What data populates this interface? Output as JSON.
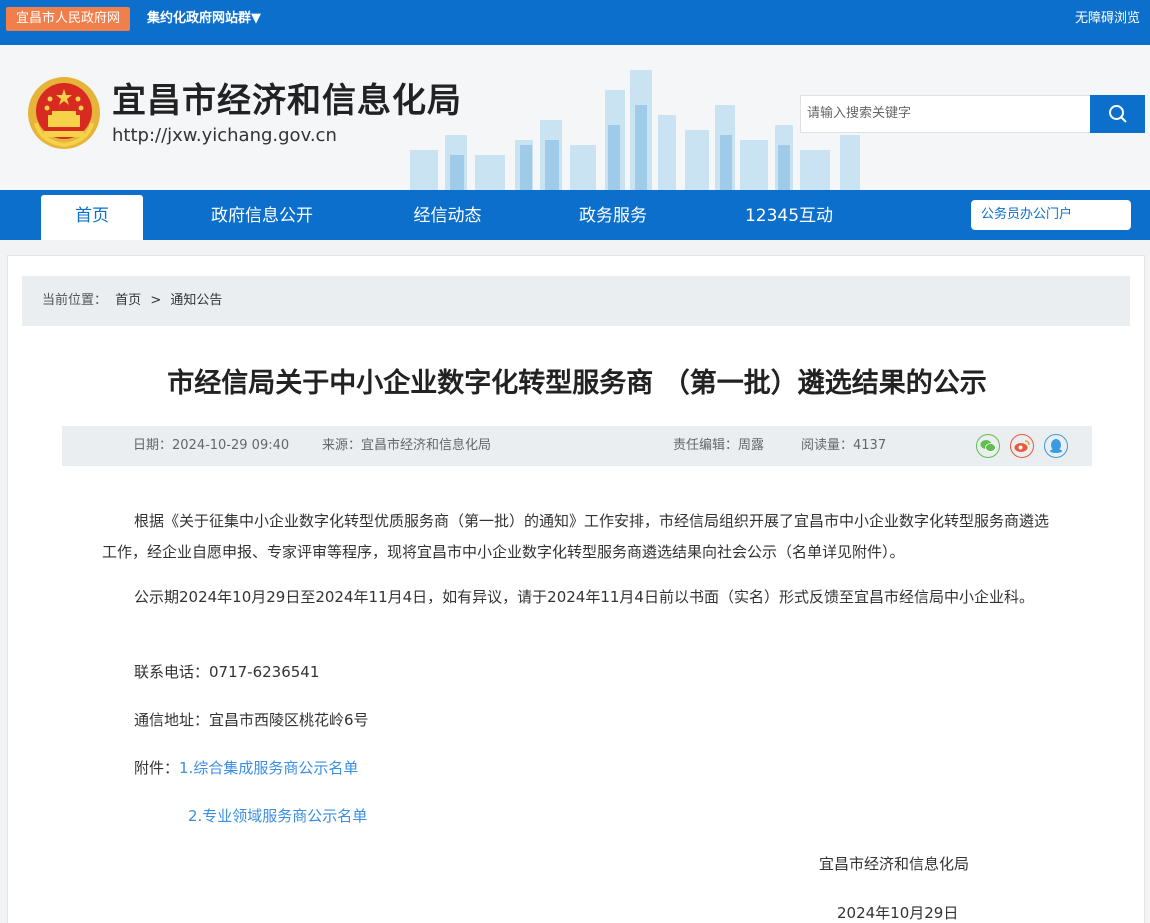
{
  "topbar": {
    "gov_link": "宜昌市人民政府网",
    "site_group": "集约化政府网站群▼",
    "accessibility": "无障碍浏览"
  },
  "header": {
    "title": "宜昌市经济和信息化局",
    "url": "http://jxw.yichang.gov.cn",
    "search_placeholder": "请输入搜索关键字"
  },
  "nav": {
    "items": [
      "首页",
      "政府信息公开",
      "经信动态",
      "政务服务",
      "12345互动"
    ],
    "active_index": 0,
    "portal": "公务员办公门户"
  },
  "breadcrumb": {
    "prefix": "当前位置：",
    "home": "首页",
    "separator": ">",
    "current": "通知公告"
  },
  "article": {
    "title": "市经信局关于中小企业数字化转型服务商 （第一批）遴选结果的公示",
    "date": "日期：2024-10-29 09:40",
    "source": "来源：宜昌市经济和信息化局",
    "editor": "责任编辑：周露",
    "views": "阅读量：4137",
    "para1": "根据《关于征集中小企业数字化转型优质服务商（第一批）的通知》工作安排，市经信局组织开展了宜昌市中小企业数字化转型服务商遴选工作，经企业自愿申报、专家评审等程序，现将宜昌市中小企业数字化转型服务商遴选结果向社会公示（名单详见附件）。",
    "para2": "公示期2024年10月29日至2024年11月4日，如有异议，请于2024年11月4日前以书面（实名）形式反馈至宜昌市经信局中小企业科。",
    "phone": "联系电话：0717-6236541",
    "address": "通信地址：宜昌市西陵区桃花岭6号",
    "attach_label": "附件：",
    "attach1": "1.综合集成服务商公示名单",
    "attach2": "2.专业领域服务商公示名单",
    "signature": "宜昌市经济和信息化局",
    "sign_date": "2024年10月29日"
  },
  "colors": {
    "brand_blue": "#0d6fcc",
    "orange": "#f07f4c",
    "link": "#3b8ee0"
  }
}
